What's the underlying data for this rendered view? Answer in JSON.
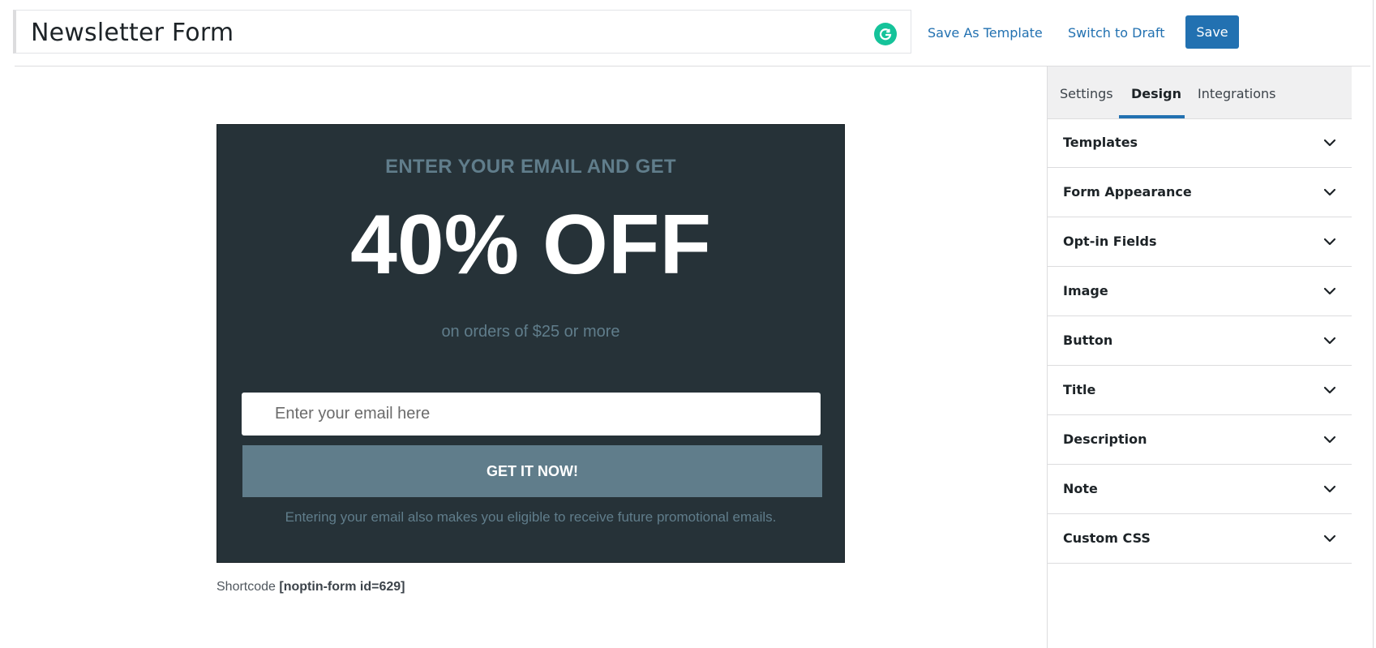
{
  "header": {
    "title": "Newsletter Form",
    "save_as_template": "Save As Template",
    "switch_to_draft": "Switch to Draft",
    "save": "Save"
  },
  "preview": {
    "top_text": "ENTER YOUR EMAIL AND GET",
    "big_text": "40% OFF",
    "sub_text": "on orders of $25 or more",
    "email_placeholder": "Enter your email here",
    "button_label": "GET IT NOW!",
    "note": "Entering your email also makes you eligible to receive future promotional emails."
  },
  "shortcode": {
    "label": "Shortcode",
    "value": "[noptin-form id=629]"
  },
  "sidebar": {
    "tabs": [
      {
        "label": "Settings"
      },
      {
        "label": "Design",
        "active": true
      },
      {
        "label": "Integrations"
      }
    ],
    "sections": [
      {
        "label": "Templates"
      },
      {
        "label": "Form Appearance"
      },
      {
        "label": "Opt-in Fields"
      },
      {
        "label": "Image"
      },
      {
        "label": "Button"
      },
      {
        "label": "Title"
      },
      {
        "label": "Description"
      },
      {
        "label": "Note"
      },
      {
        "label": "Custom CSS"
      }
    ]
  },
  "icons": {
    "grammarly": "grammarly-icon",
    "chevron": "chevron-down-icon"
  },
  "colors": {
    "accent": "#2271b1",
    "preview_bg": "#263238",
    "preview_muted": "#607d8b",
    "grammarly": "#15c39a"
  }
}
